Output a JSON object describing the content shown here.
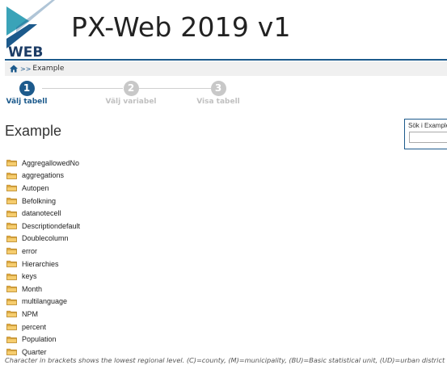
{
  "header": {
    "logo_text": "WEB",
    "title": "PX-Web 2019 v1"
  },
  "breadcrumb": {
    "separator": ">>",
    "current": "Example"
  },
  "stepper": {
    "steps": [
      {
        "number": "1",
        "label": "Välj tabell",
        "state": "active"
      },
      {
        "number": "2",
        "label": "Välj variabel",
        "state": "inactive"
      },
      {
        "number": "3",
        "label": "Visa tabell",
        "state": "inactive"
      }
    ]
  },
  "main": {
    "page_title": "Example"
  },
  "search": {
    "label": "Sök i Example",
    "value": ""
  },
  "folders": [
    "AggregallowedNo",
    "aggregations",
    "Autopen",
    "Befolkning",
    "datanotecell",
    "Descriptiondefault",
    "Doublecolumn",
    "error",
    "Hierarchies",
    "keys",
    "Month",
    "multilanguage",
    "NPM",
    "percent",
    "Population",
    "Quarter"
  ],
  "footnote": "Character in brackets shows the lowest regional level. (C)=county, (M)=municipality, (BU)=Basic statistical unit, (UD)=urban district",
  "colors": {
    "accent": "#1c5a8c",
    "folder": "#e8b24a",
    "inactive_step": "#c8c8c8"
  }
}
